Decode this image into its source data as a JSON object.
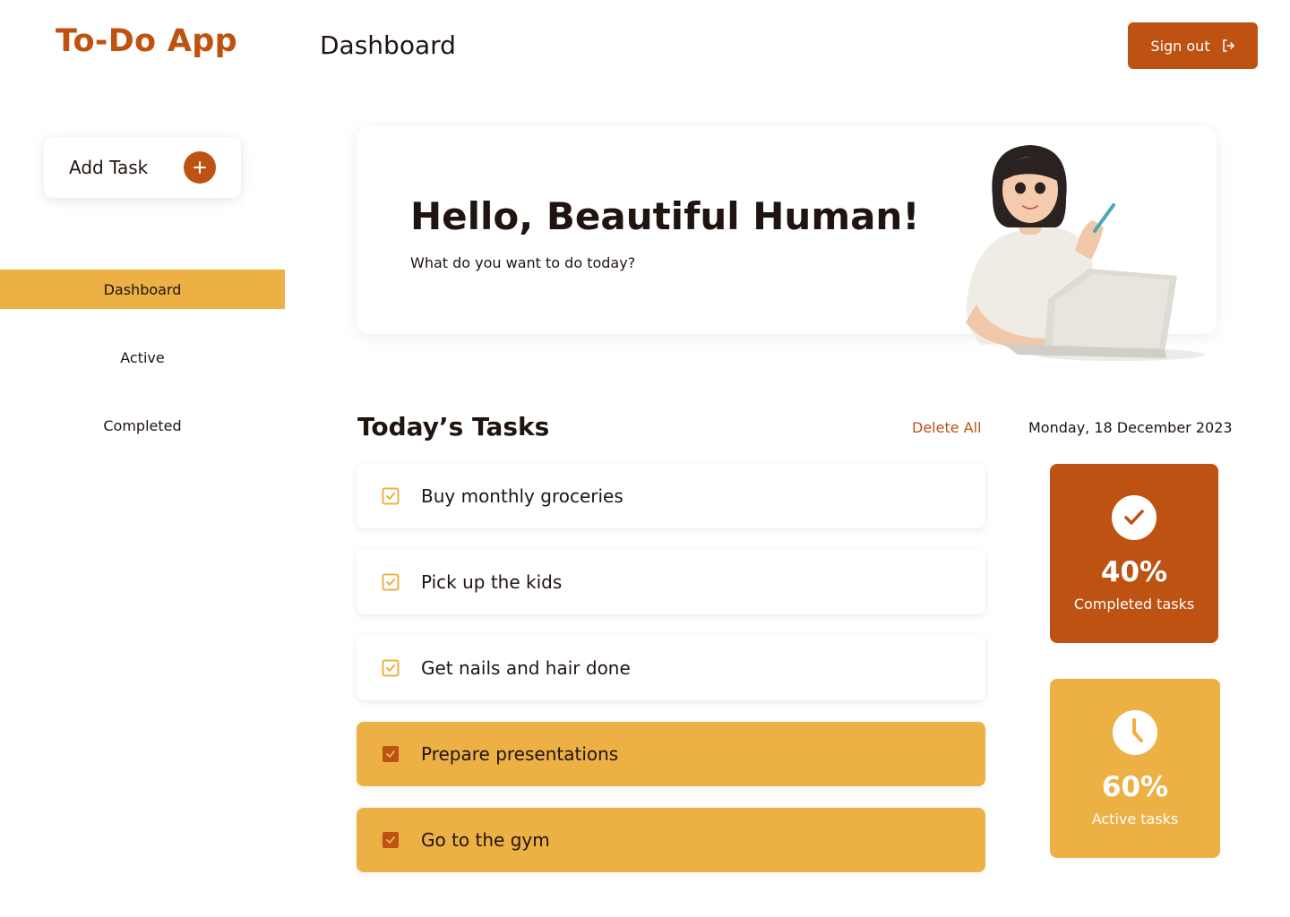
{
  "app": {
    "brand": "To-Do App",
    "page_title": "Dashboard"
  },
  "header": {
    "signout_label": "Sign out"
  },
  "sidebar": {
    "add_task_label": "Add Task",
    "items": [
      {
        "label": "Dashboard",
        "active": true
      },
      {
        "label": "Active",
        "active": false
      },
      {
        "label": "Completed",
        "active": false
      }
    ]
  },
  "hero": {
    "title": "Hello, Beautiful Human!",
    "subtitle": "What do you want to do today?"
  },
  "tasks": {
    "title": "Today’s Tasks",
    "delete_all": "Delete All",
    "date": "Monday, 18 December 2023",
    "items": [
      {
        "text": "Buy monthly groceries",
        "done": false
      },
      {
        "text": "Pick up the kids",
        "done": false
      },
      {
        "text": "Get nails and hair done",
        "done": false
      },
      {
        "text": "Prepare presentations",
        "done": true
      },
      {
        "text": "Go to the gym",
        "done": true
      }
    ]
  },
  "stats": {
    "completed": {
      "value": "40%",
      "label": "Completed tasks",
      "icon": "check-circle-icon"
    },
    "active": {
      "value": "60%",
      "label": "Active tasks",
      "icon": "clock-icon"
    }
  },
  "colors": {
    "primary": "#bd5213",
    "accent": "#ecb045",
    "text": "#1f1410"
  }
}
